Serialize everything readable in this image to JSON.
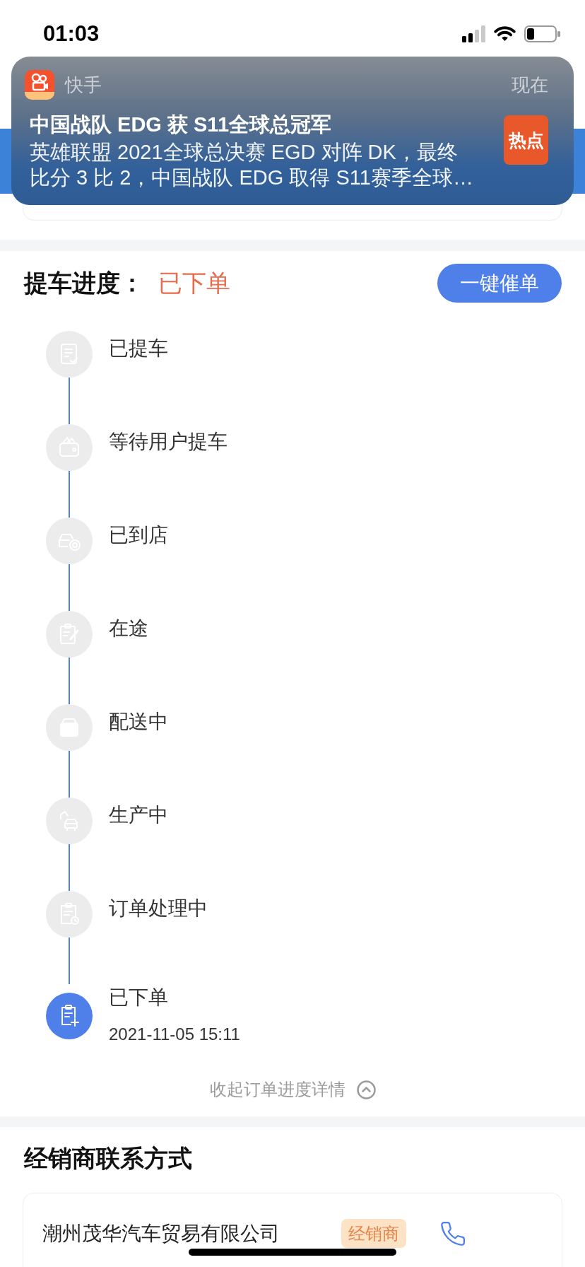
{
  "status_bar": {
    "time": "01:03"
  },
  "notification": {
    "app": "快手",
    "time": "现在",
    "title": "中国战队 EDG 获 S11全球总冠军",
    "body_lines": [
      "英雄联盟 2021全球总决赛 EGD 对阵 DK，最终",
      "比分 3 比 2，中国战队 EDG 取得 S11赛季全球…"
    ],
    "tag": "热点"
  },
  "progress": {
    "title": "提车进度：",
    "status": "已下单",
    "button": "一键催单",
    "steps": [
      {
        "label": "已提车",
        "active": false
      },
      {
        "label": "等待用户提车",
        "active": false
      },
      {
        "label": "已到店",
        "active": false
      },
      {
        "label": "在途",
        "active": false
      },
      {
        "label": "配送中",
        "active": false
      },
      {
        "label": "生产中",
        "active": false
      },
      {
        "label": "订单处理中",
        "active": false
      },
      {
        "label": "已下单",
        "time": "2021-11-05 15:11",
        "active": true
      }
    ],
    "collapse_link": "收起订单进度详情"
  },
  "dealer_contact": {
    "title": "经销商联系方式",
    "dealers": [
      {
        "name": "潮州茂华汽车贸易有限公司",
        "tag": "经销商"
      }
    ]
  }
}
